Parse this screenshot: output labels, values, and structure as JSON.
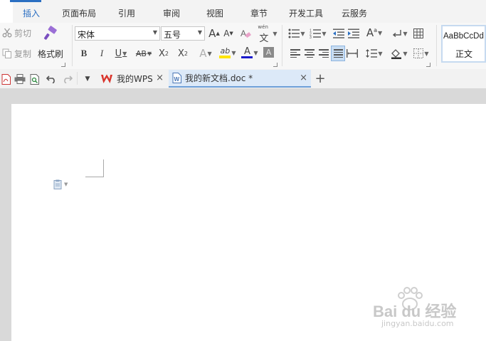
{
  "menu": {
    "tabs": [
      "插入",
      "页面布局",
      "引用",
      "审阅",
      "视图",
      "章节",
      "开发工具",
      "云服务"
    ]
  },
  "ribbon": {
    "cut_label": "剪切",
    "copy_label": "复制",
    "format_painter_label": "格式刷",
    "font_name": "宋体",
    "font_size": "五号",
    "increase_font": "A",
    "decrease_font": "A",
    "pinyin_glyph": "文",
    "pinyin_small": "wén",
    "bold": "B",
    "italic": "I",
    "underline": "U",
    "strike": "AB",
    "superscript": "X",
    "subscript": "X",
    "text_effect": "A",
    "highlight": "ab",
    "font_color": "A",
    "char_shade": "A",
    "style_preview": "AaBbCcDd",
    "style_name": "正文"
  },
  "tabs": {
    "wps_home": "我的WPS",
    "document": "我的新文档.doc *",
    "close_glyph": "×",
    "new_glyph": "+"
  },
  "watermark": {
    "brand": "Bai du 经验",
    "url": "jingyan.baidu.com"
  },
  "colors": {
    "accent": "#2b6fc2",
    "wps_red": "#d9342b",
    "highlight_yellow": "#ffe500",
    "font_color_blue": "#1a1acc"
  }
}
